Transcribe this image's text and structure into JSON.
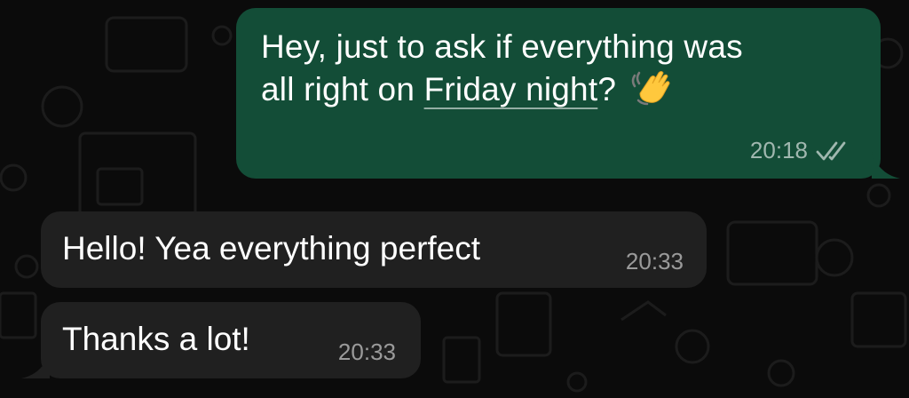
{
  "messages": [
    {
      "direction": "outgoing",
      "text_before": "Hey, just to ask if everything was",
      "text_line2_prefix": "all right on ",
      "link_text": "Friday night",
      "text_after": "?",
      "emoji": "waving-hand-icon",
      "time": "20:18",
      "status": "read"
    },
    {
      "direction": "incoming",
      "text": "Hello! Yea everything perfect",
      "time": "20:33"
    },
    {
      "direction": "incoming",
      "text": "Thanks a lot!",
      "time": "20:33"
    }
  ],
  "colors": {
    "background": "#0b0b0b",
    "outgoing_bubble": "#134d37",
    "incoming_bubble": "#202020",
    "text": "#ffffff",
    "meta_text": "#9a9a9a"
  }
}
